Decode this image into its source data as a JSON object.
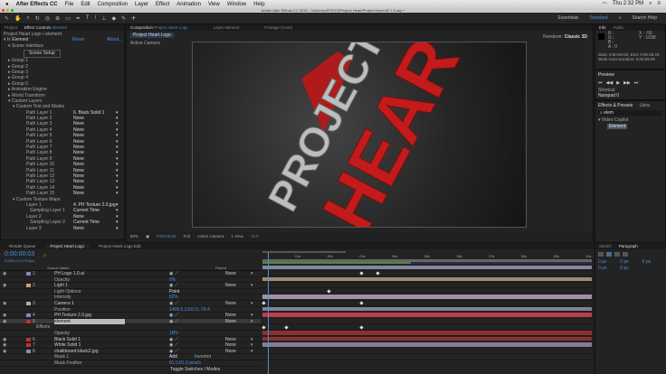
{
  "menubar": {
    "app": "After Effects CC",
    "items": [
      "File",
      "Edit",
      "Composition",
      "Layer",
      "Effect",
      "Animation",
      "View",
      "Window",
      "Help"
    ],
    "clock": "Thu 2:32 PM"
  },
  "titlebar": {
    "title": "Adobe After Effects CC 2015 - /Volumes/RTN E2/Project Heart/Project Heart AE 1.0.aep *"
  },
  "toolbar": {
    "workspaces": [
      "Essentials",
      "Standard"
    ],
    "search": "Search Help"
  },
  "effect_controls": {
    "tab_project": "Project",
    "tab": "Effect Controls",
    "tab_layer": "element",
    "breadcrumb": "Project Heart Logo • element",
    "effect": "Element",
    "reset": "Reset",
    "about": "About...",
    "rows": [
      {
        "label": "Scene Interface",
        "indent": 1
      },
      {
        "label": "Scene Setup",
        "button": true
      },
      {
        "label": "Group 1",
        "indent": 1
      },
      {
        "label": "Group 2",
        "indent": 1
      },
      {
        "label": "Group 3",
        "indent": 1
      },
      {
        "label": "Group 4",
        "indent": 1
      },
      {
        "label": "Group 5",
        "indent": 1
      },
      {
        "label": "Animation Engine",
        "indent": 1
      },
      {
        "label": "World Transform",
        "indent": 1
      },
      {
        "label": "Custom Layers",
        "indent": 1
      },
      {
        "label": "Custom Text and Masks",
        "indent": 2
      }
    ],
    "path_layers": [
      [
        "Path Layer 1",
        "6. Black Solid 1"
      ],
      [
        "Path Layer 2",
        "None"
      ],
      [
        "Path Layer 3",
        "None"
      ],
      [
        "Path Layer 4",
        "None"
      ],
      [
        "Path Layer 5",
        "None"
      ],
      [
        "Path Layer 6",
        "None"
      ],
      [
        "Path Layer 7",
        "None"
      ],
      [
        "Path Layer 8",
        "None"
      ],
      [
        "Path Layer 9",
        "None"
      ],
      [
        "Path Layer 10",
        "None"
      ],
      [
        "Path Layer 11",
        "None"
      ],
      [
        "Path Layer 12",
        "None"
      ],
      [
        "Path Layer 13",
        "None"
      ],
      [
        "Path Layer 14",
        "None"
      ],
      [
        "Path Layer 15",
        "None"
      ]
    ],
    "texture_title": "Custom Texture Maps",
    "texture_layers": [
      [
        "Layer 1",
        "4. PH Texture 2.0.jpg"
      ],
      [
        "Sampling Layer 1",
        "Current Time"
      ],
      [
        "Layer 2",
        "None"
      ],
      [
        "Sampling Layer 2",
        "Current Time"
      ],
      [
        "Layer 3",
        "None"
      ]
    ]
  },
  "composition": {
    "tab": "Composition",
    "comp_name": "Project Heart Logo",
    "tab_layer": "Layer element",
    "tab_footage": "Footage (none)",
    "chip": "Project Heart Logo",
    "camera_label": "Active Camera",
    "renderer_label": "Renderer:",
    "renderer": "Classic 3D",
    "viewer_text": [
      "PROJECT",
      "HEART"
    ],
    "bar": {
      "zoom": "50%",
      "time": "0:00:00:03",
      "resolution": "Full",
      "view": "Active Camera",
      "views": "1 View",
      "exposure": "+0.0"
    }
  },
  "info": {
    "tab": "Info",
    "tab_audio": "Audio",
    "r": "R :",
    "g": "G :",
    "b": "B :",
    "a": "A : 0",
    "x": "X : -56",
    "y": "Y : 1038",
    "start_end": "Start: 0:00:00:00, End: 0:00:08:23",
    "duration": "Work Area Duration: 0:00:09:00"
  },
  "preview": {
    "title": "Preview",
    "shortcut_label": "Shortcut",
    "shortcut": "Numpad 0"
  },
  "effects_presets": {
    "title": "Effects & Presets",
    "tab_libs": "Libra",
    "search": "elem",
    "category": "Video Copilot",
    "item": "Element"
  },
  "paragraph": {
    "tab_sketch": "Sketch",
    "title": "Paragraph",
    "values": [
      "0 px",
      "0 px",
      "0 px",
      "0 px",
      "0 px"
    ]
  },
  "timeline": {
    "tab_rq": "Render Queue",
    "tab": "Project Heart Logo",
    "tab2": "Project Heart Logo Edit",
    "timecode": "0:00:00:03",
    "fps": "00003 (23.976 fps)",
    "col_source": "Source Name",
    "col_parent": "Parent",
    "toggle": "Toggle Switches / Modes",
    "ruler": [
      "01s",
      "02s",
      "03s",
      "04s",
      "05s",
      "06s",
      "07s",
      "08s",
      "09s",
      "10s"
    ],
    "layers": [
      {
        "num": "1",
        "name": "PH Logo 1.0.ai",
        "parent": "None",
        "label": "#8a86b8",
        "track": "#85859f",
        "keys": []
      },
      {
        "name": "Opacity",
        "value": "0%",
        "sub": true,
        "keys": [
          0.3,
          0.35
        ]
      },
      {
        "num": "2",
        "name": "Light 1",
        "parent": "None",
        "label": "#c9a27e",
        "track": "#a08a74",
        "keys": []
      },
      {
        "name": "Light Options",
        "value": "Point",
        "sub": true,
        "keys": []
      },
      {
        "name": "Intensity",
        "value": "82%",
        "sub": true,
        "keys": [
          0.2
        ]
      },
      {
        "num": "3",
        "name": "Camera 1",
        "parent": "None",
        "label": "#c9a0a8",
        "track": "#a190a2",
        "keys": []
      },
      {
        "name": "Position",
        "value": "1408.5,1333.5,-79.4",
        "sub": true,
        "keys": [
          0.0,
          0.3
        ]
      },
      {
        "num": "4",
        "name": "PH Texture 2.0.jpg",
        "parent": "None",
        "label": "#8a86b8",
        "track": "#7f7f98",
        "keys": []
      },
      {
        "num": "5",
        "name": "element",
        "parent": "None",
        "label": "#c03038",
        "track": "#b8404a",
        "keys": [],
        "selected": true
      },
      {
        "name": "Effects",
        "sub": true,
        "keys": []
      },
      {
        "name": "Opacity",
        "value": "18%",
        "sub": true,
        "keys": [
          0.0,
          0.07,
          0.3
        ]
      },
      {
        "num": "6",
        "name": "Black Solid 1",
        "parent": "None",
        "label": "#c03038",
        "track": "#8c2f36",
        "keys": []
      },
      {
        "num": "7",
        "name": "White Solid 1",
        "parent": "None",
        "label": "#c03038",
        "track": "#8c2f36",
        "keys": []
      },
      {
        "num": "8",
        "name": "chalkboard-black2.jpg",
        "parent": "None",
        "label": "#8a86b8",
        "track": "#7f7f98",
        "keys": []
      },
      {
        "name": "Mask 1",
        "value": "Add",
        "extra": "Inverted",
        "sub": true,
        "keys": []
      },
      {
        "name": "Mask Feather",
        "value": "81.0,81.0 pixels",
        "sub": true,
        "keys": []
      }
    ]
  }
}
